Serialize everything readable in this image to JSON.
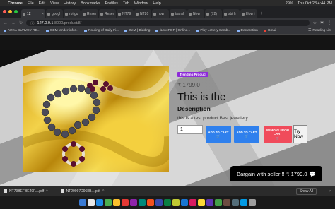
{
  "menubar": {
    "app": "Chrome",
    "items": [
      "File",
      "Edit",
      "View",
      "History",
      "Bookmarks",
      "Profiles",
      "Tab",
      "Window",
      "Help"
    ],
    "battery": "29%",
    "datetime": "Thu Oct 28  4:44 PM"
  },
  "tabs": [
    {
      "label": "12",
      "active": true
    },
    {
      "label": "googl"
    },
    {
      "label": "rbi gu"
    },
    {
      "label": "Reser"
    },
    {
      "label": "Reser"
    },
    {
      "label": "NT79"
    },
    {
      "label": "NT20"
    },
    {
      "label": "how"
    },
    {
      "label": "transl"
    },
    {
      "label": "New"
    },
    {
      "label": "(72)"
    },
    {
      "label": "sbi h"
    },
    {
      "label": "How i"
    }
  ],
  "address": {
    "host": "127.0.0.1",
    "path": ":8000/product/8/"
  },
  "bookmarks": [
    "ARKA SURVEY RE...",
    "GEM tender infor...",
    "Routing of Daily Fi...",
    "GeM | Bidding",
    "iLovePDF | Online...",
    "Play Lottery Samb...",
    "Declaration",
    "Gmail"
  ],
  "reading_list": "Reading List",
  "product": {
    "badge": "Trending Product",
    "price": "₹ 1799.0",
    "title": "This is the",
    "description_heading": "Description",
    "description": "this is a test product Best jewellery",
    "quantity": "1",
    "btn_add_to_cart_1": "ADD TO CART",
    "btn_add_to_cart_2": "ADD TO CART",
    "btn_remove": "REMOVE FROM CART",
    "try_now": "Try Now"
  },
  "bargain": "Bargain with seller !! ₹ 1799.0",
  "downloads": [
    {
      "name": "NT79BEFBE49F....pdf"
    },
    {
      "name": "NT20097D968B....pdf"
    }
  ],
  "show_all": "Show All",
  "colors": {
    "badge": "#8e2bd9",
    "blue_button": "#2f80ed",
    "red_button": "#f04b5b"
  }
}
